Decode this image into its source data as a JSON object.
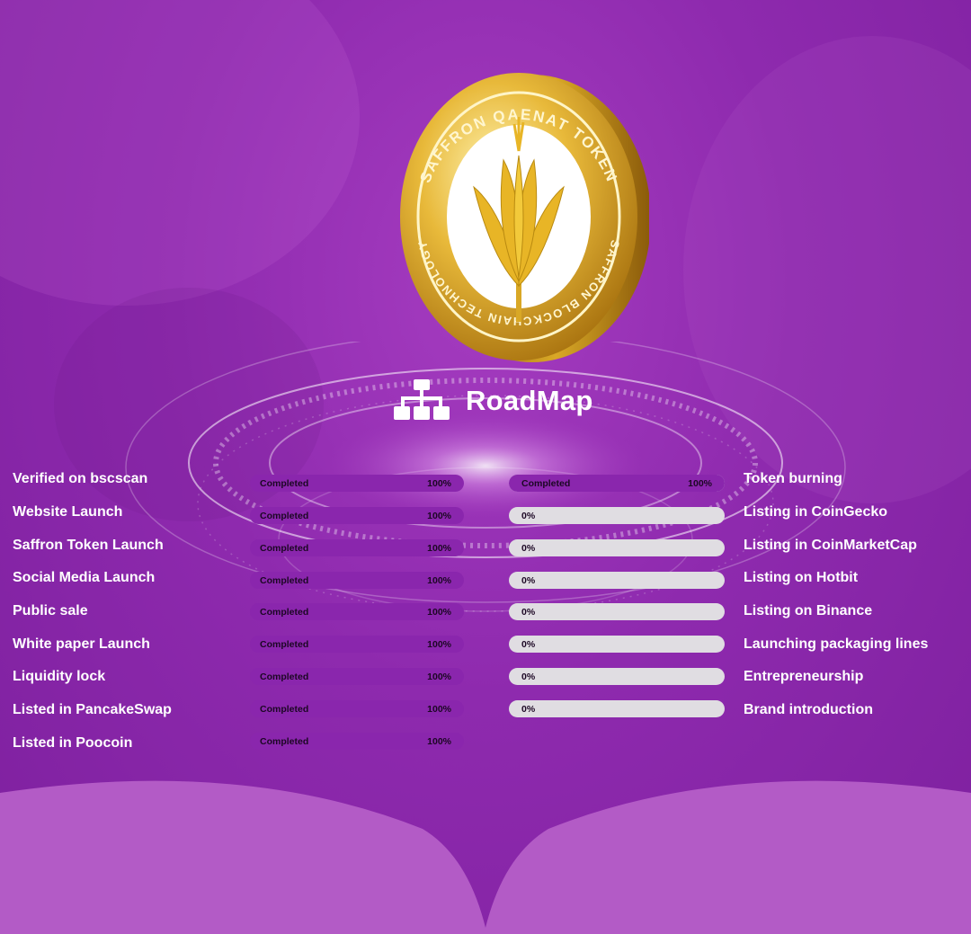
{
  "brand": {
    "coin_text_top": "SAFFRON QAENAT TOKEN",
    "coin_text_bottom": "SAFFRON BLOCKCHAIN TECHNOLOGY",
    "colors": {
      "purple": "#8e2aae",
      "gold": "#d9a826",
      "bar_track": "#e0dde2"
    }
  },
  "section": {
    "title": "RoadMap",
    "icon": "sitemap-icon"
  },
  "left_items": [
    {
      "label": "Verified on bscscan",
      "status": "Completed",
      "percent": "100%"
    },
    {
      "label": "Website Launch",
      "status": "Completed",
      "percent": "100%"
    },
    {
      "label": "Saffron Token Launch",
      "status": "Completed",
      "percent": "100%"
    },
    {
      "label": "Social Media Launch",
      "status": "Completed",
      "percent": "100%"
    },
    {
      "label": "Public sale",
      "status": "Completed",
      "percent": "100%"
    },
    {
      "label": "White paper Launch",
      "status": "Completed",
      "percent": "100%"
    },
    {
      "label": "Liquidity lock",
      "status": "Completed",
      "percent": "100%"
    },
    {
      "label": "Listed in PancakeSwap",
      "status": "Completed",
      "percent": "100%"
    },
    {
      "label": "Listed in Poocoin",
      "status": "Completed",
      "percent": "100%"
    }
  ],
  "right_items": [
    {
      "label": "Token burning",
      "status": "Completed",
      "percent": "100%",
      "progress": 1.0
    },
    {
      "label": "Listing in CoinGecko",
      "status": "",
      "percent": "0%",
      "progress": 0
    },
    {
      "label": "Listing in CoinMarketCap",
      "status": "",
      "percent": "0%",
      "progress": 0
    },
    {
      "label": "Listing on Hotbit",
      "status": "",
      "percent": "0%",
      "progress": 0
    },
    {
      "label": "Listing on Binance",
      "status": "",
      "percent": "0%",
      "progress": 0
    },
    {
      "label": "Launching packaging lines",
      "status": "",
      "percent": "0%",
      "progress": 0
    },
    {
      "label": "Entrepreneurship",
      "status": "",
      "percent": "0%",
      "progress": 0
    },
    {
      "label": "Brand introduction",
      "status": "",
      "percent": "0%",
      "progress": 0
    }
  ]
}
